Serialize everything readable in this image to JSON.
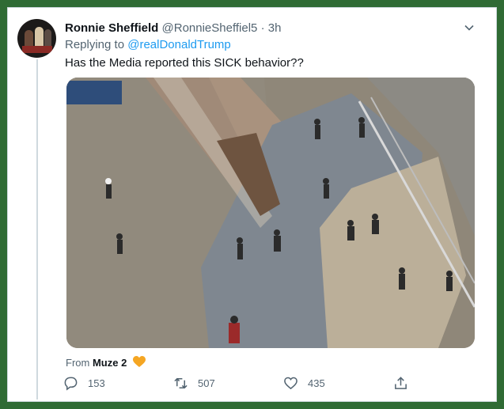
{
  "tweet": {
    "display_name": "Ronnie Sheffield",
    "handle": "@RonnieSheffiel5",
    "separator": "·",
    "time": "3h",
    "reply_prefix": "Replying to",
    "reply_to": "@realDonaldTrump",
    "text": "Has the Media reported this SICK behavior??",
    "source_prefix": "From",
    "source_name": "Muze 2",
    "source_icon": "yellow-heart-icon",
    "avatar_icon": "avatar-photo"
  },
  "actions": {
    "reply_count": "153",
    "retweet_count": "507",
    "like_count": "435",
    "reply_icon": "comment-icon",
    "retweet_icon": "retweet-icon",
    "like_icon": "heart-outline-icon",
    "share_icon": "share-icon"
  },
  "colors": {
    "border_frame": "#2f6b34",
    "link": "#1d9bf0",
    "secondary_text": "#536471",
    "primary_text": "#0f1419",
    "heart": "#f5a623"
  }
}
